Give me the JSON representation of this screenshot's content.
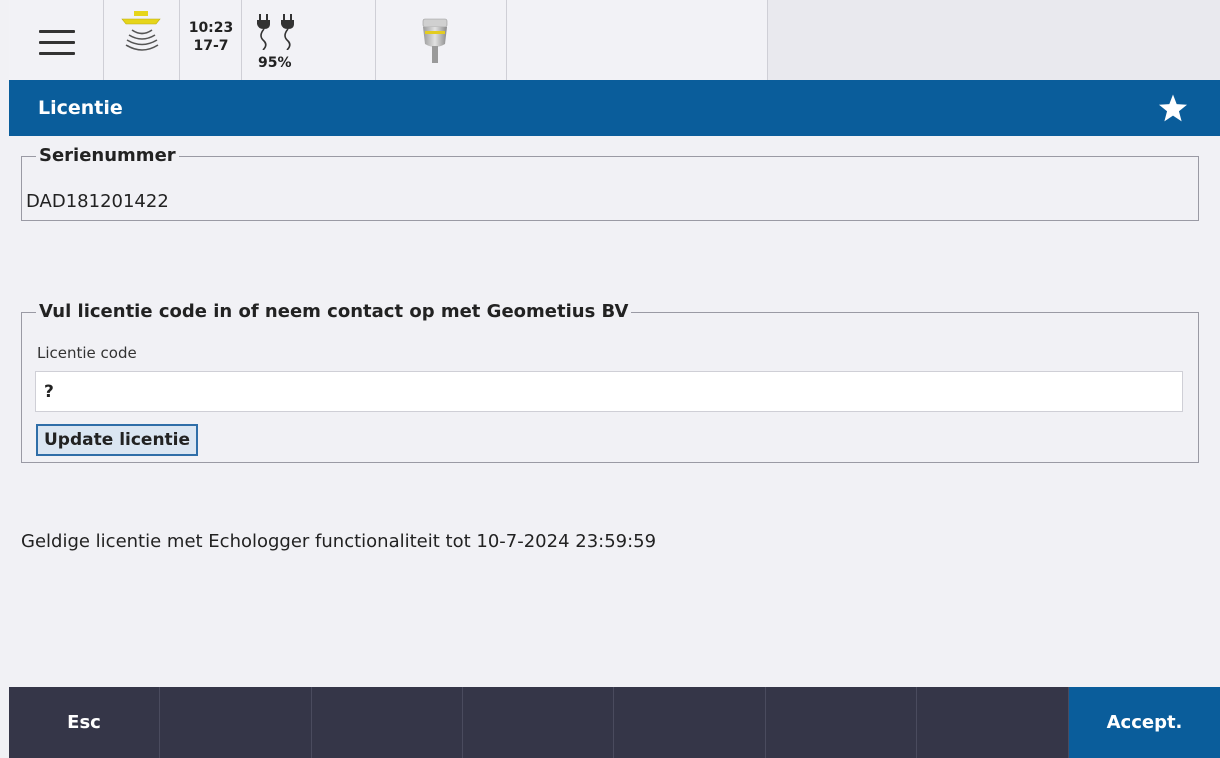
{
  "statusbar": {
    "time": "10:23",
    "date": "17-7",
    "battery": "95%",
    "icons": [
      "menu-icon",
      "sonar-icon",
      "power-plug-icon",
      "gnss-receiver-icon"
    ]
  },
  "titlebar": {
    "title": "Licentie",
    "favorite_icon": "star-icon"
  },
  "serial": {
    "legend": "Serienummer",
    "value": "DAD181201422"
  },
  "license": {
    "legend": "Vul licentie code in of neem contact op met Geometius BV",
    "code_label": "Licentie code",
    "code_value": "?",
    "update_label": "Update licentie"
  },
  "status_text": "Geldige licentie met Echologger functionaliteit tot 10-7-2024 23:59:59",
  "softkeys": {
    "esc": "Esc",
    "accept": "Accept."
  },
  "colors": {
    "accent": "#0a5d9b",
    "softkey_bar": "#353648",
    "background": "#f1f1f5"
  }
}
